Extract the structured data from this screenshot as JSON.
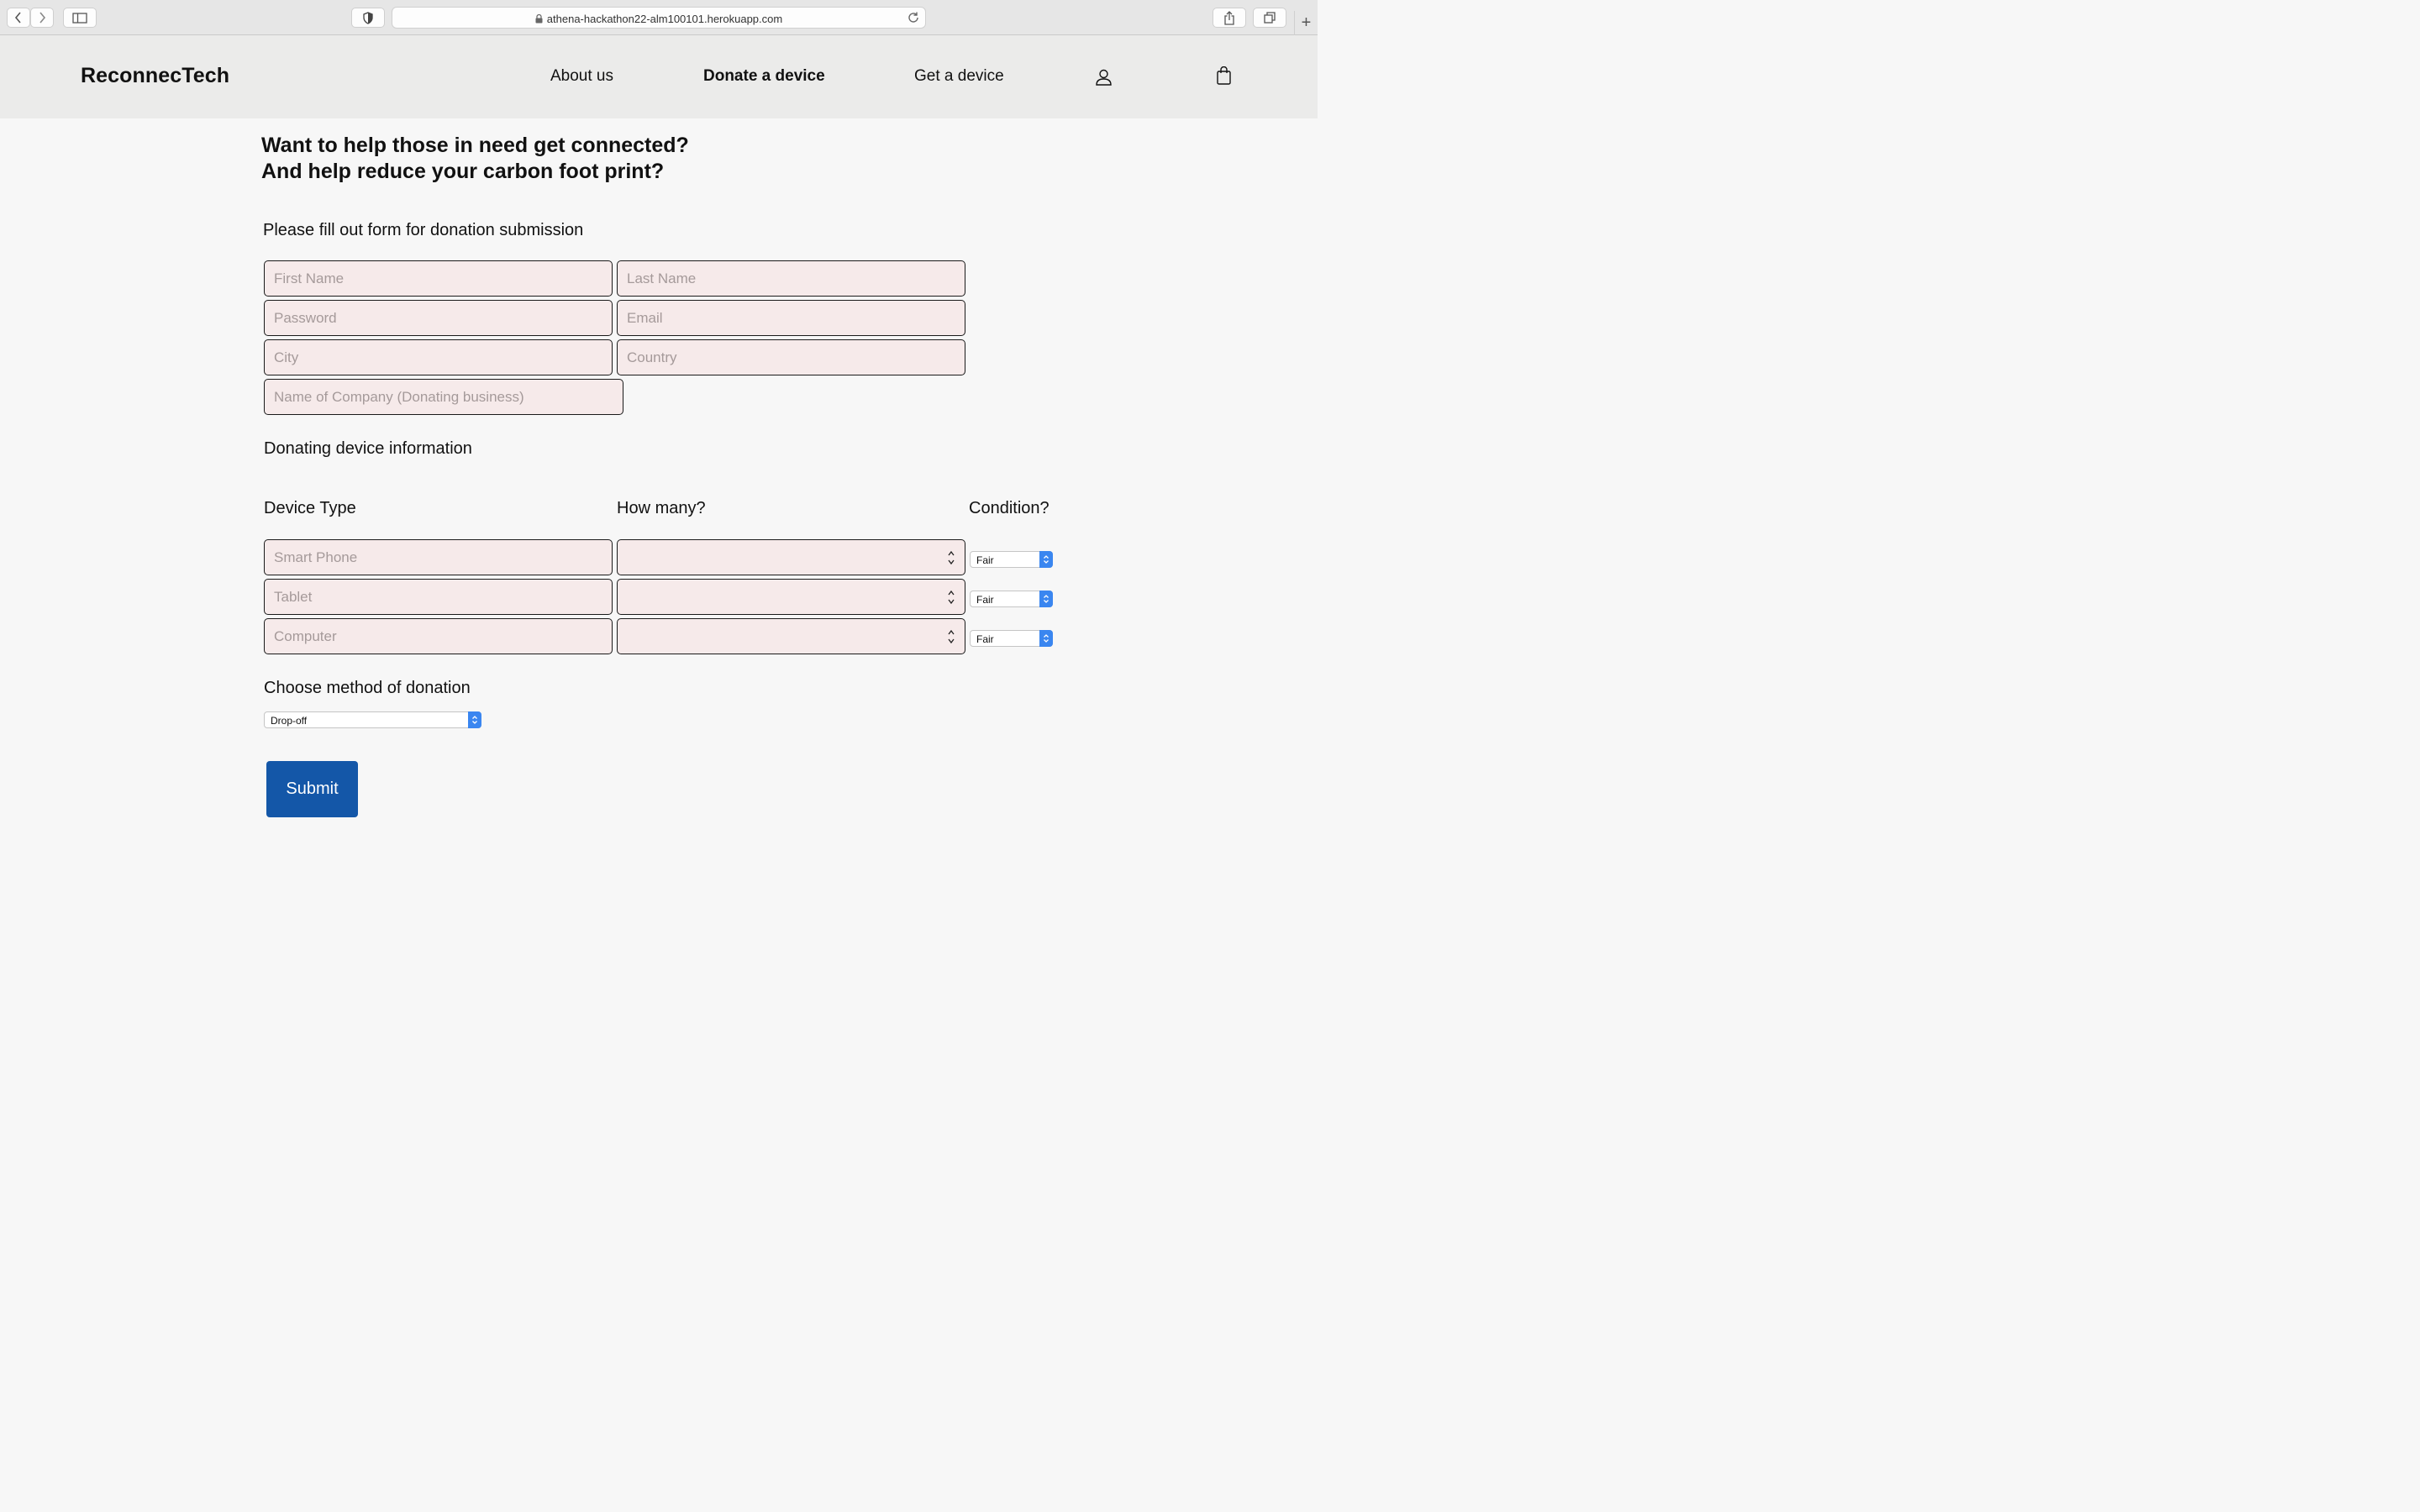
{
  "browser": {
    "url": "athena-hackathon22-alm100101.herokuapp.com"
  },
  "header": {
    "brand": "ReconnecTech",
    "nav": [
      {
        "label": "About us"
      },
      {
        "label": "Donate a device"
      },
      {
        "label": "Get a device"
      }
    ]
  },
  "hero": {
    "line1": "Want to help those in need get connected?",
    "line2": "And help reduce your carbon foot print?"
  },
  "form": {
    "intro": "Please fill out form for donation submission",
    "first_name_placeholder": "First Name",
    "last_name_placeholder": "Last Name",
    "password_placeholder": "Password",
    "email_placeholder": "Email",
    "city_placeholder": "City",
    "country_placeholder": "Country",
    "company_placeholder": "Name of Company (Donating business)"
  },
  "device_section": {
    "title": "Donating device information",
    "col_type": "Device Type",
    "col_count": "How many?",
    "col_condition": "Condition?",
    "rows": [
      {
        "type_placeholder": "Smart Phone",
        "condition": "Fair"
      },
      {
        "type_placeholder": "Tablet",
        "condition": "Fair"
      },
      {
        "type_placeholder": "Computer",
        "condition": "Fair"
      }
    ]
  },
  "donation_method": {
    "title": "Choose method of donation",
    "selected": "Drop-off"
  },
  "submit_label": "Submit"
}
